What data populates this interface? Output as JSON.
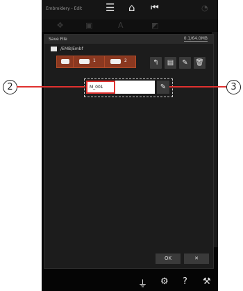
{
  "statusbar": {
    "app_title": "Embroidery - Edit"
  },
  "dialog": {
    "title": "Save File",
    "size": "0.1/64.0MB",
    "path": "/EMB/Embf",
    "devices": [
      {
        "num": "1"
      },
      {
        "num": "2"
      }
    ],
    "filename": "M_001",
    "ok_label": "OK",
    "cancel_label": "✕"
  },
  "callouts": {
    "left": "2",
    "right": "3"
  },
  "colors": {
    "accent": "#e0312f",
    "device_button": "#8a3820"
  }
}
